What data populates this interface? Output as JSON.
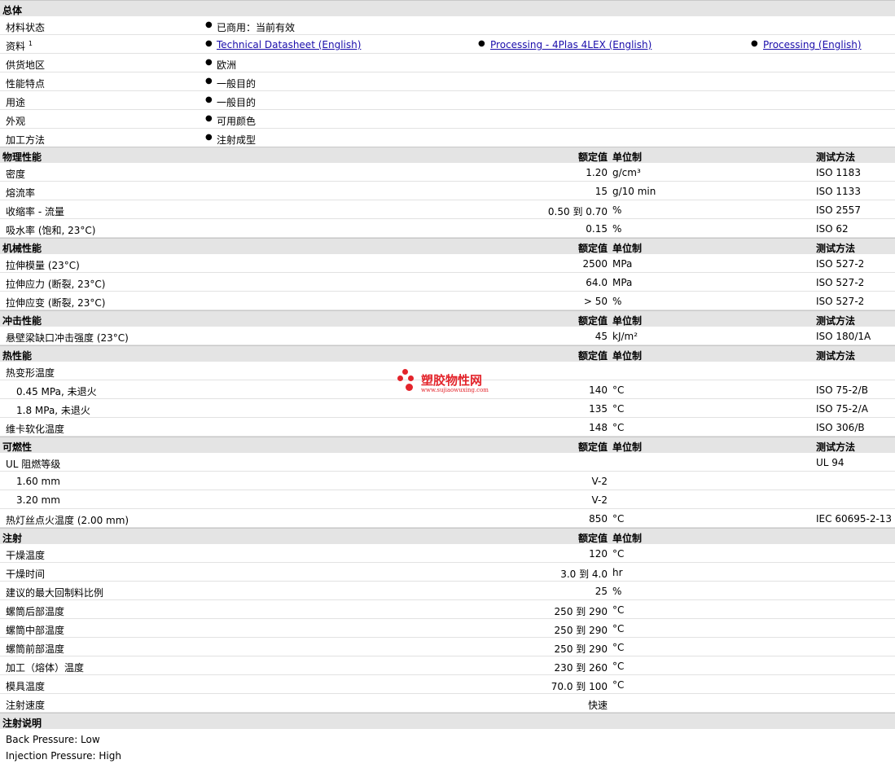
{
  "sections": {
    "general": {
      "title": "总体"
    },
    "physical": {
      "title": "物理性能",
      "nominal": "额定值",
      "unit": "单位制",
      "test": "测试方法"
    },
    "mechanical": {
      "title": "机械性能",
      "nominal": "额定值",
      "unit": "单位制",
      "test": "测试方法"
    },
    "impact": {
      "title": "冲击性能",
      "nominal": "额定值",
      "unit": "单位制",
      "test": "测试方法"
    },
    "thermal": {
      "title": "热性能",
      "nominal": "额定值",
      "unit": "单位制",
      "test": "测试方法"
    },
    "flammability": {
      "title": "可燃性",
      "nominal": "额定值",
      "unit": "单位制",
      "test": "测试方法"
    },
    "injection": {
      "title": "注射",
      "nominal": "额定值",
      "unit": "单位制"
    },
    "notes": {
      "title": "注射说明"
    }
  },
  "general": {
    "status_label": "材料状态",
    "status_value": "已商用：当前有效",
    "docs_label": "资料",
    "docs_sup": "1",
    "doc1": "Technical Datasheet (English)",
    "doc2": "Processing - 4Plas 4LEX (English)",
    "doc3": "Processing (English)",
    "region_label": "供货地区",
    "region_value": "欧洲",
    "feature_label": "性能特点",
    "feature_value": "一般目的",
    "use_label": "用途",
    "use_value": "一般目的",
    "appearance_label": "外观",
    "appearance_value": "可用颜色",
    "method_label": "加工方法",
    "method_value": "注射成型"
  },
  "physical": [
    {
      "label": "密度",
      "nom": "1.20",
      "unit": "g/cm³",
      "test": "ISO 1183"
    },
    {
      "label": "熔流率",
      "nom": "15",
      "unit": "g/10 min",
      "test": "ISO 1133"
    },
    {
      "label": "收缩率 - 流量",
      "nom": "0.50 到  0.70",
      "unit": "%",
      "test": "ISO 2557"
    },
    {
      "label": "吸水率 (饱和, 23°C)",
      "nom": "0.15",
      "unit": "%",
      "test": "ISO 62"
    }
  ],
  "mechanical": [
    {
      "label": "拉伸模量 (23°C)",
      "nom": "2500",
      "unit": "MPa",
      "test": "ISO 527-2"
    },
    {
      "label": "拉伸应力 (断裂, 23°C)",
      "nom": "64.0",
      "unit": "MPa",
      "test": "ISO 527-2"
    },
    {
      "label": "拉伸应变 (断裂, 23°C)",
      "nom": "> 50",
      "unit": "%",
      "test": "ISO 527-2"
    }
  ],
  "impact": [
    {
      "label": "悬壁梁缺口冲击强度 (23°C)",
      "nom": "45",
      "unit": "kJ/m²",
      "test": "ISO 180/1A"
    }
  ],
  "thermal": [
    {
      "label": "热变形温度",
      "nom": "",
      "unit": "",
      "test": ""
    },
    {
      "label": "0.45 MPa, 未退火",
      "nom": "140",
      "unit": "°C",
      "test": "ISO 75-2/B"
    },
    {
      "label": "1.8 MPa, 未退火",
      "nom": "135",
      "unit": "°C",
      "test": "ISO 75-2/A"
    },
    {
      "label": "维卡软化温度",
      "nom": "148",
      "unit": "°C",
      "test": "ISO 306/B"
    }
  ],
  "flammability": [
    {
      "label": "UL 阻燃等级",
      "nom": "",
      "unit": "",
      "test": "UL 94"
    },
    {
      "label": "1.60 mm",
      "nom": "V-2",
      "unit": "",
      "test": ""
    },
    {
      "label": "3.20 mm",
      "nom": "V-2",
      "unit": "",
      "test": ""
    },
    {
      "label": "热灯丝点火温度 (2.00 mm)",
      "nom": "850",
      "unit": "°C",
      "test": "IEC 60695-2-13"
    }
  ],
  "injection": [
    {
      "label": "干燥温度",
      "nom": "120",
      "unit": "°C"
    },
    {
      "label": "干燥时间",
      "nom": "3.0 到  4.0",
      "unit": "hr"
    },
    {
      "label": "建议的最大回制料比例",
      "nom": "25",
      "unit": "%"
    },
    {
      "label": "螺筒后部温度",
      "nom": "250 到  290",
      "unit": "°C"
    },
    {
      "label": "螺筒中部温度",
      "nom": "250 到  290",
      "unit": "°C"
    },
    {
      "label": "螺筒前部温度",
      "nom": "250 到  290",
      "unit": "°C"
    },
    {
      "label": "加工（熔体）温度",
      "nom": "230 到  260",
      "unit": "°C"
    },
    {
      "label": "模具温度",
      "nom": "70.0 到  100",
      "unit": "°C"
    },
    {
      "label": "注射速度",
      "nom": "快速",
      "unit": ""
    }
  ],
  "notes": {
    "line1": "Back Pressure: Low",
    "line2": "Injection Pressure: High"
  },
  "watermark": {
    "name": "塑胶物性网",
    "url": "www.sujiaowuxing.com"
  }
}
